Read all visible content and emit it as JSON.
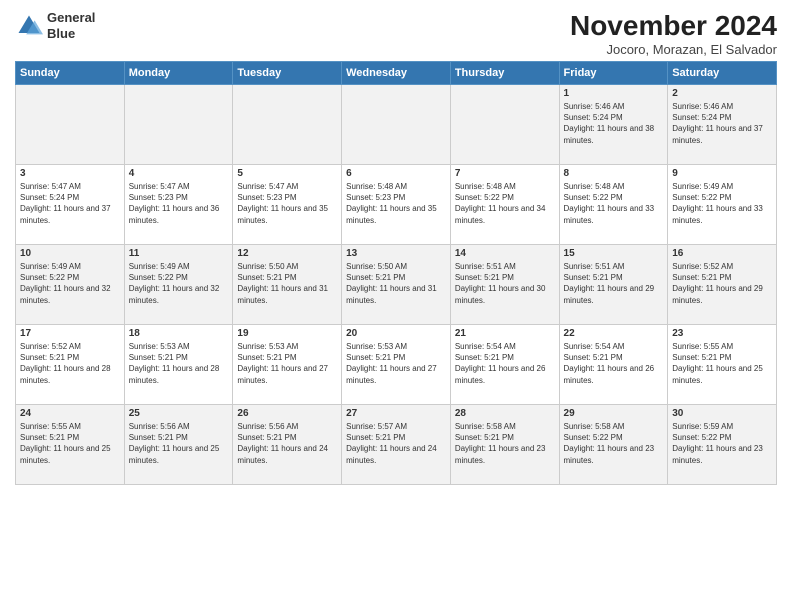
{
  "header": {
    "logo_line1": "General",
    "logo_line2": "Blue",
    "month_title": "November 2024",
    "location": "Jocoro, Morazan, El Salvador"
  },
  "days_of_week": [
    "Sunday",
    "Monday",
    "Tuesday",
    "Wednesday",
    "Thursday",
    "Friday",
    "Saturday"
  ],
  "weeks": [
    [
      {
        "day": "",
        "info": ""
      },
      {
        "day": "",
        "info": ""
      },
      {
        "day": "",
        "info": ""
      },
      {
        "day": "",
        "info": ""
      },
      {
        "day": "",
        "info": ""
      },
      {
        "day": "1",
        "info": "Sunrise: 5:46 AM\nSunset: 5:24 PM\nDaylight: 11 hours and 38 minutes."
      },
      {
        "day": "2",
        "info": "Sunrise: 5:46 AM\nSunset: 5:24 PM\nDaylight: 11 hours and 37 minutes."
      }
    ],
    [
      {
        "day": "3",
        "info": "Sunrise: 5:47 AM\nSunset: 5:24 PM\nDaylight: 11 hours and 37 minutes."
      },
      {
        "day": "4",
        "info": "Sunrise: 5:47 AM\nSunset: 5:23 PM\nDaylight: 11 hours and 36 minutes."
      },
      {
        "day": "5",
        "info": "Sunrise: 5:47 AM\nSunset: 5:23 PM\nDaylight: 11 hours and 35 minutes."
      },
      {
        "day": "6",
        "info": "Sunrise: 5:48 AM\nSunset: 5:23 PM\nDaylight: 11 hours and 35 minutes."
      },
      {
        "day": "7",
        "info": "Sunrise: 5:48 AM\nSunset: 5:22 PM\nDaylight: 11 hours and 34 minutes."
      },
      {
        "day": "8",
        "info": "Sunrise: 5:48 AM\nSunset: 5:22 PM\nDaylight: 11 hours and 33 minutes."
      },
      {
        "day": "9",
        "info": "Sunrise: 5:49 AM\nSunset: 5:22 PM\nDaylight: 11 hours and 33 minutes."
      }
    ],
    [
      {
        "day": "10",
        "info": "Sunrise: 5:49 AM\nSunset: 5:22 PM\nDaylight: 11 hours and 32 minutes."
      },
      {
        "day": "11",
        "info": "Sunrise: 5:49 AM\nSunset: 5:22 PM\nDaylight: 11 hours and 32 minutes."
      },
      {
        "day": "12",
        "info": "Sunrise: 5:50 AM\nSunset: 5:21 PM\nDaylight: 11 hours and 31 minutes."
      },
      {
        "day": "13",
        "info": "Sunrise: 5:50 AM\nSunset: 5:21 PM\nDaylight: 11 hours and 31 minutes."
      },
      {
        "day": "14",
        "info": "Sunrise: 5:51 AM\nSunset: 5:21 PM\nDaylight: 11 hours and 30 minutes."
      },
      {
        "day": "15",
        "info": "Sunrise: 5:51 AM\nSunset: 5:21 PM\nDaylight: 11 hours and 29 minutes."
      },
      {
        "day": "16",
        "info": "Sunrise: 5:52 AM\nSunset: 5:21 PM\nDaylight: 11 hours and 29 minutes."
      }
    ],
    [
      {
        "day": "17",
        "info": "Sunrise: 5:52 AM\nSunset: 5:21 PM\nDaylight: 11 hours and 28 minutes."
      },
      {
        "day": "18",
        "info": "Sunrise: 5:53 AM\nSunset: 5:21 PM\nDaylight: 11 hours and 28 minutes."
      },
      {
        "day": "19",
        "info": "Sunrise: 5:53 AM\nSunset: 5:21 PM\nDaylight: 11 hours and 27 minutes."
      },
      {
        "day": "20",
        "info": "Sunrise: 5:53 AM\nSunset: 5:21 PM\nDaylight: 11 hours and 27 minutes."
      },
      {
        "day": "21",
        "info": "Sunrise: 5:54 AM\nSunset: 5:21 PM\nDaylight: 11 hours and 26 minutes."
      },
      {
        "day": "22",
        "info": "Sunrise: 5:54 AM\nSunset: 5:21 PM\nDaylight: 11 hours and 26 minutes."
      },
      {
        "day": "23",
        "info": "Sunrise: 5:55 AM\nSunset: 5:21 PM\nDaylight: 11 hours and 25 minutes."
      }
    ],
    [
      {
        "day": "24",
        "info": "Sunrise: 5:55 AM\nSunset: 5:21 PM\nDaylight: 11 hours and 25 minutes."
      },
      {
        "day": "25",
        "info": "Sunrise: 5:56 AM\nSunset: 5:21 PM\nDaylight: 11 hours and 25 minutes."
      },
      {
        "day": "26",
        "info": "Sunrise: 5:56 AM\nSunset: 5:21 PM\nDaylight: 11 hours and 24 minutes."
      },
      {
        "day": "27",
        "info": "Sunrise: 5:57 AM\nSunset: 5:21 PM\nDaylight: 11 hours and 24 minutes."
      },
      {
        "day": "28",
        "info": "Sunrise: 5:58 AM\nSunset: 5:21 PM\nDaylight: 11 hours and 23 minutes."
      },
      {
        "day": "29",
        "info": "Sunrise: 5:58 AM\nSunset: 5:22 PM\nDaylight: 11 hours and 23 minutes."
      },
      {
        "day": "30",
        "info": "Sunrise: 5:59 AM\nSunset: 5:22 PM\nDaylight: 11 hours and 23 minutes."
      }
    ]
  ]
}
